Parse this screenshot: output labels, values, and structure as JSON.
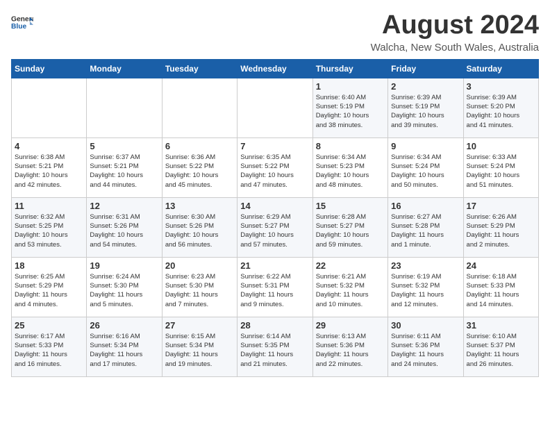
{
  "logo": {
    "line1": "General",
    "line2": "Blue"
  },
  "title": "August 2024",
  "subtitle": "Walcha, New South Wales, Australia",
  "weekdays": [
    "Sunday",
    "Monday",
    "Tuesday",
    "Wednesday",
    "Thursday",
    "Friday",
    "Saturday"
  ],
  "weeks": [
    [
      {
        "day": "",
        "text": ""
      },
      {
        "day": "",
        "text": ""
      },
      {
        "day": "",
        "text": ""
      },
      {
        "day": "",
        "text": ""
      },
      {
        "day": "1",
        "text": "Sunrise: 6:40 AM\nSunset: 5:19 PM\nDaylight: 10 hours\nand 38 minutes."
      },
      {
        "day": "2",
        "text": "Sunrise: 6:39 AM\nSunset: 5:19 PM\nDaylight: 10 hours\nand 39 minutes."
      },
      {
        "day": "3",
        "text": "Sunrise: 6:39 AM\nSunset: 5:20 PM\nDaylight: 10 hours\nand 41 minutes."
      }
    ],
    [
      {
        "day": "4",
        "text": "Sunrise: 6:38 AM\nSunset: 5:21 PM\nDaylight: 10 hours\nand 42 minutes."
      },
      {
        "day": "5",
        "text": "Sunrise: 6:37 AM\nSunset: 5:21 PM\nDaylight: 10 hours\nand 44 minutes."
      },
      {
        "day": "6",
        "text": "Sunrise: 6:36 AM\nSunset: 5:22 PM\nDaylight: 10 hours\nand 45 minutes."
      },
      {
        "day": "7",
        "text": "Sunrise: 6:35 AM\nSunset: 5:22 PM\nDaylight: 10 hours\nand 47 minutes."
      },
      {
        "day": "8",
        "text": "Sunrise: 6:34 AM\nSunset: 5:23 PM\nDaylight: 10 hours\nand 48 minutes."
      },
      {
        "day": "9",
        "text": "Sunrise: 6:34 AM\nSunset: 5:24 PM\nDaylight: 10 hours\nand 50 minutes."
      },
      {
        "day": "10",
        "text": "Sunrise: 6:33 AM\nSunset: 5:24 PM\nDaylight: 10 hours\nand 51 minutes."
      }
    ],
    [
      {
        "day": "11",
        "text": "Sunrise: 6:32 AM\nSunset: 5:25 PM\nDaylight: 10 hours\nand 53 minutes."
      },
      {
        "day": "12",
        "text": "Sunrise: 6:31 AM\nSunset: 5:26 PM\nDaylight: 10 hours\nand 54 minutes."
      },
      {
        "day": "13",
        "text": "Sunrise: 6:30 AM\nSunset: 5:26 PM\nDaylight: 10 hours\nand 56 minutes."
      },
      {
        "day": "14",
        "text": "Sunrise: 6:29 AM\nSunset: 5:27 PM\nDaylight: 10 hours\nand 57 minutes."
      },
      {
        "day": "15",
        "text": "Sunrise: 6:28 AM\nSunset: 5:27 PM\nDaylight: 10 hours\nand 59 minutes."
      },
      {
        "day": "16",
        "text": "Sunrise: 6:27 AM\nSunset: 5:28 PM\nDaylight: 11 hours\nand 1 minute."
      },
      {
        "day": "17",
        "text": "Sunrise: 6:26 AM\nSunset: 5:29 PM\nDaylight: 11 hours\nand 2 minutes."
      }
    ],
    [
      {
        "day": "18",
        "text": "Sunrise: 6:25 AM\nSunset: 5:29 PM\nDaylight: 11 hours\nand 4 minutes."
      },
      {
        "day": "19",
        "text": "Sunrise: 6:24 AM\nSunset: 5:30 PM\nDaylight: 11 hours\nand 5 minutes."
      },
      {
        "day": "20",
        "text": "Sunrise: 6:23 AM\nSunset: 5:30 PM\nDaylight: 11 hours\nand 7 minutes."
      },
      {
        "day": "21",
        "text": "Sunrise: 6:22 AM\nSunset: 5:31 PM\nDaylight: 11 hours\nand 9 minutes."
      },
      {
        "day": "22",
        "text": "Sunrise: 6:21 AM\nSunset: 5:32 PM\nDaylight: 11 hours\nand 10 minutes."
      },
      {
        "day": "23",
        "text": "Sunrise: 6:19 AM\nSunset: 5:32 PM\nDaylight: 11 hours\nand 12 minutes."
      },
      {
        "day": "24",
        "text": "Sunrise: 6:18 AM\nSunset: 5:33 PM\nDaylight: 11 hours\nand 14 minutes."
      }
    ],
    [
      {
        "day": "25",
        "text": "Sunrise: 6:17 AM\nSunset: 5:33 PM\nDaylight: 11 hours\nand 16 minutes."
      },
      {
        "day": "26",
        "text": "Sunrise: 6:16 AM\nSunset: 5:34 PM\nDaylight: 11 hours\nand 17 minutes."
      },
      {
        "day": "27",
        "text": "Sunrise: 6:15 AM\nSunset: 5:34 PM\nDaylight: 11 hours\nand 19 minutes."
      },
      {
        "day": "28",
        "text": "Sunrise: 6:14 AM\nSunset: 5:35 PM\nDaylight: 11 hours\nand 21 minutes."
      },
      {
        "day": "29",
        "text": "Sunrise: 6:13 AM\nSunset: 5:36 PM\nDaylight: 11 hours\nand 22 minutes."
      },
      {
        "day": "30",
        "text": "Sunrise: 6:11 AM\nSunset: 5:36 PM\nDaylight: 11 hours\nand 24 minutes."
      },
      {
        "day": "31",
        "text": "Sunrise: 6:10 AM\nSunset: 5:37 PM\nDaylight: 11 hours\nand 26 minutes."
      }
    ]
  ]
}
